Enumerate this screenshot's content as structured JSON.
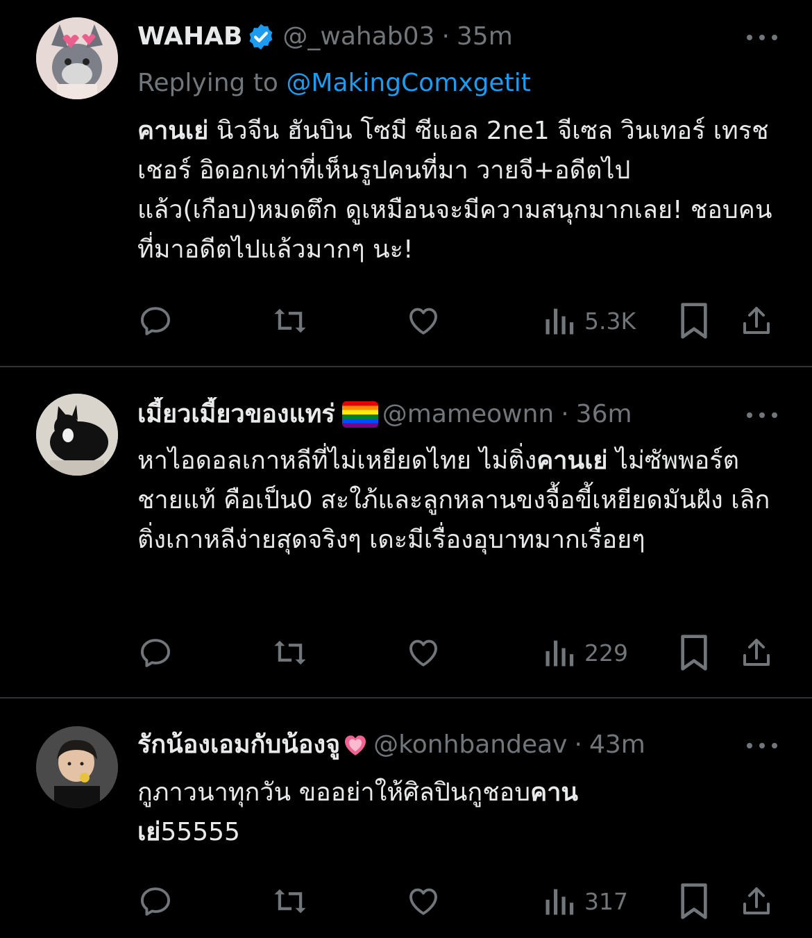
{
  "tweets": [
    {
      "name": "WAHAB",
      "verified": true,
      "handle": "@_wahab03",
      "time": "35m",
      "replying_prefix": "Replying to ",
      "replying_to": "@MakingComxgetit",
      "body_bold": "คานเย่",
      "body_rest": " นิวจีน ฮันบิน โซมี ซีแอล 2ne1 จีเซล วินเทอร์ เทรชเชอร์ อิดอกเท่าที่เห็นรูปคนที่มา วายจี+อดีตไปแล้ว(เกือบ)หมดตึก ดูเหมือนจะมีความสนุกมากเลย! ชอบคนที่มาอดีตไปแล้วมากๆ นะ!",
      "views": "5.3K"
    },
    {
      "name": "เมี้ยวเมี้ยวของแทร่",
      "handle": "@mameownn",
      "time": "36m",
      "body_1": "หาไอดอลเกาหลีที่ไม่เหยียดไทย ไม่ติ่ง",
      "body_bold": "คานเย่",
      "body_2": " ไม่ซัพพอร์ตชายแท้ คือเป็น0 สะใภ้และลูกหลานขงจื้อขี้เหยียดมันฝัง เลิกติ่งเกาหลีง่ายสุดจริงๆ เดะมีเรื่องอุบาทมากเรื่อยๆ",
      "views": "229"
    },
    {
      "name": "รักน้องเอมกับน้องจู",
      "handle": "@konhbandeav",
      "time": "43m",
      "body_1": "กูภาวนาทุกวัน ขออย่าให้ศิลปินกูชอบ",
      "body_bold": "คานเย่",
      "body_2": "55555",
      "views": "317"
    }
  ],
  "separator": "·",
  "colors": {
    "background": "#000000",
    "text": "#e7e9ea",
    "muted": "#71767b",
    "link": "#1d9bf0",
    "verified": "#1d9bf0"
  }
}
